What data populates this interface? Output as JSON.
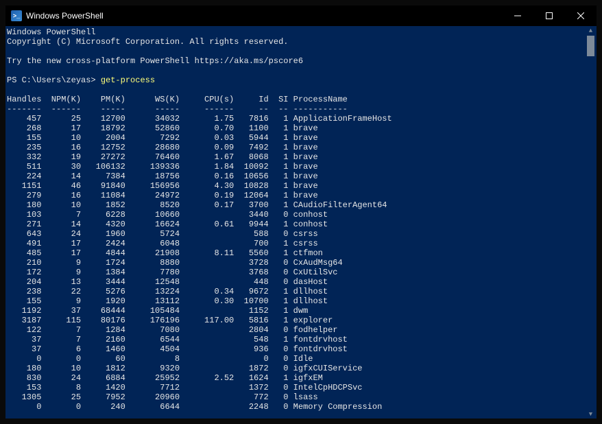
{
  "window": {
    "title": "Windows PowerShell",
    "icon_label": ">_"
  },
  "banner": {
    "line1": "Windows PowerShell",
    "line2": "Copyright (C) Microsoft Corporation. All rights reserved.",
    "line3": "Try the new cross-platform PowerShell https://aka.ms/pscore6"
  },
  "prompt": {
    "text": "PS C:\\Users\\zeyas> ",
    "command": "get-process"
  },
  "columns": [
    "Handles",
    "NPM(K)",
    "PM(K)",
    "WS(K)",
    "CPU(s)",
    "Id",
    "SI",
    "ProcessName"
  ],
  "rows": [
    {
      "handles": 457,
      "npm": 25,
      "pm": 12700,
      "ws": 34032,
      "cpu": "1.75",
      "id": 7816,
      "si": 1,
      "name": "ApplicationFrameHost"
    },
    {
      "handles": 268,
      "npm": 17,
      "pm": 18792,
      "ws": 52860,
      "cpu": "0.70",
      "id": 1100,
      "si": 1,
      "name": "brave"
    },
    {
      "handles": 155,
      "npm": 10,
      "pm": 2004,
      "ws": 7292,
      "cpu": "0.03",
      "id": 5944,
      "si": 1,
      "name": "brave"
    },
    {
      "handles": 235,
      "npm": 16,
      "pm": 12752,
      "ws": 28680,
      "cpu": "0.09",
      "id": 7492,
      "si": 1,
      "name": "brave"
    },
    {
      "handles": 332,
      "npm": 19,
      "pm": 27272,
      "ws": 76460,
      "cpu": "1.67",
      "id": 8068,
      "si": 1,
      "name": "brave"
    },
    {
      "handles": 511,
      "npm": 30,
      "pm": 106132,
      "ws": 139336,
      "cpu": "1.84",
      "id": 10092,
      "si": 1,
      "name": "brave"
    },
    {
      "handles": 224,
      "npm": 14,
      "pm": 7384,
      "ws": 18756,
      "cpu": "0.16",
      "id": 10656,
      "si": 1,
      "name": "brave"
    },
    {
      "handles": 1151,
      "npm": 46,
      "pm": 91840,
      "ws": 156956,
      "cpu": "4.30",
      "id": 10828,
      "si": 1,
      "name": "brave"
    },
    {
      "handles": 279,
      "npm": 16,
      "pm": 11084,
      "ws": 24972,
      "cpu": "0.19",
      "id": 12064,
      "si": 1,
      "name": "brave"
    },
    {
      "handles": 180,
      "npm": 10,
      "pm": 1852,
      "ws": 8520,
      "cpu": "0.17",
      "id": 3700,
      "si": 1,
      "name": "CAudioFilterAgent64"
    },
    {
      "handles": 103,
      "npm": 7,
      "pm": 6228,
      "ws": 10660,
      "cpu": "",
      "id": 3440,
      "si": 0,
      "name": "conhost"
    },
    {
      "handles": 271,
      "npm": 14,
      "pm": 4320,
      "ws": 16624,
      "cpu": "0.61",
      "id": 9944,
      "si": 1,
      "name": "conhost"
    },
    {
      "handles": 643,
      "npm": 24,
      "pm": 1960,
      "ws": 5724,
      "cpu": "",
      "id": 588,
      "si": 0,
      "name": "csrss"
    },
    {
      "handles": 491,
      "npm": 17,
      "pm": 2424,
      "ws": 6048,
      "cpu": "",
      "id": 700,
      "si": 1,
      "name": "csrss"
    },
    {
      "handles": 485,
      "npm": 17,
      "pm": 4844,
      "ws": 21908,
      "cpu": "8.11",
      "id": 5560,
      "si": 1,
      "name": "ctfmon"
    },
    {
      "handles": 210,
      "npm": 9,
      "pm": 1724,
      "ws": 8880,
      "cpu": "",
      "id": 3728,
      "si": 0,
      "name": "CxAudMsg64"
    },
    {
      "handles": 172,
      "npm": 9,
      "pm": 1384,
      "ws": 7780,
      "cpu": "",
      "id": 3768,
      "si": 0,
      "name": "CxUtilSvc"
    },
    {
      "handles": 204,
      "npm": 13,
      "pm": 3444,
      "ws": 12548,
      "cpu": "",
      "id": 448,
      "si": 0,
      "name": "dasHost"
    },
    {
      "handles": 238,
      "npm": 22,
      "pm": 5276,
      "ws": 13224,
      "cpu": "0.34",
      "id": 9672,
      "si": 1,
      "name": "dllhost"
    },
    {
      "handles": 155,
      "npm": 9,
      "pm": 1920,
      "ws": 13112,
      "cpu": "0.30",
      "id": 10700,
      "si": 1,
      "name": "dllhost"
    },
    {
      "handles": 1192,
      "npm": 37,
      "pm": 68444,
      "ws": 105484,
      "cpu": "",
      "id": 1152,
      "si": 1,
      "name": "dwm"
    },
    {
      "handles": 3187,
      "npm": 115,
      "pm": 80176,
      "ws": 176196,
      "cpu": "117.00",
      "id": 5816,
      "si": 1,
      "name": "explorer"
    },
    {
      "handles": 122,
      "npm": 7,
      "pm": 1284,
      "ws": 7080,
      "cpu": "",
      "id": 2804,
      "si": 0,
      "name": "fodhelper"
    },
    {
      "handles": 37,
      "npm": 7,
      "pm": 2160,
      "ws": 6544,
      "cpu": "",
      "id": 548,
      "si": 1,
      "name": "fontdrvhost"
    },
    {
      "handles": 37,
      "npm": 6,
      "pm": 1460,
      "ws": 4504,
      "cpu": "",
      "id": 936,
      "si": 0,
      "name": "fontdrvhost"
    },
    {
      "handles": 0,
      "npm": 0,
      "pm": 60,
      "ws": 8,
      "cpu": "",
      "id": 0,
      "si": 0,
      "name": "Idle"
    },
    {
      "handles": 180,
      "npm": 10,
      "pm": 1812,
      "ws": 9320,
      "cpu": "",
      "id": 1872,
      "si": 0,
      "name": "igfxCUIService"
    },
    {
      "handles": 830,
      "npm": 24,
      "pm": 6884,
      "ws": 25952,
      "cpu": "2.52",
      "id": 1624,
      "si": 1,
      "name": "igfxEM"
    },
    {
      "handles": 153,
      "npm": 8,
      "pm": 1420,
      "ws": 7712,
      "cpu": "",
      "id": 1372,
      "si": 0,
      "name": "IntelCpHDCPSvc"
    },
    {
      "handles": 1305,
      "npm": 25,
      "pm": 7952,
      "ws": 20960,
      "cpu": "",
      "id": 772,
      "si": 0,
      "name": "lsass"
    },
    {
      "handles": 0,
      "npm": 0,
      "pm": 240,
      "ws": 6644,
      "cpu": "",
      "id": 2248,
      "si": 0,
      "name": "Memory Compression"
    }
  ]
}
